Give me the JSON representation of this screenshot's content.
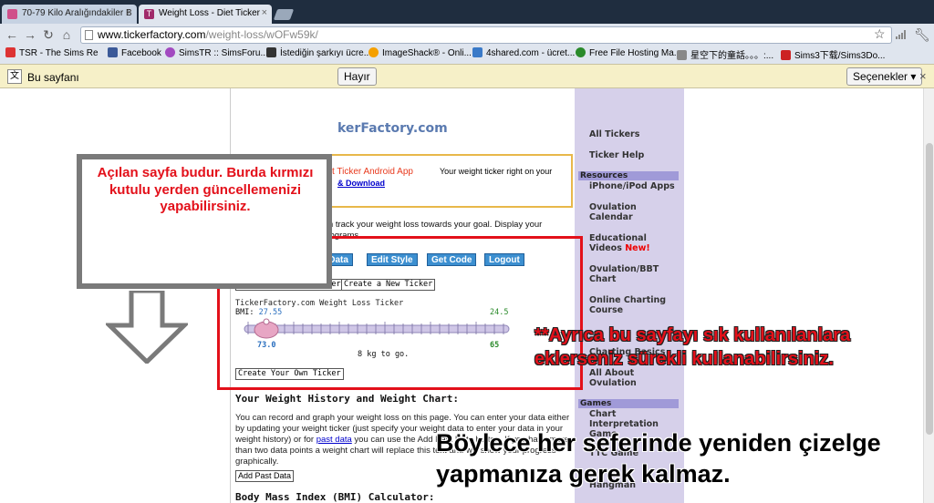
{
  "browser": {
    "tabs": [
      {
        "title": "70-79 Kilo Aralığındakiler B",
        "active": false
      },
      {
        "title": "Weight Loss - Diet Ticker",
        "active": true
      }
    ],
    "url_prefix": "www.tickerfactory.com",
    "url_suffix": "/weight-loss/wOFw59k/",
    "bookmarks": [
      "TSR - The Sims Re",
      "Facebook",
      "SimsTR :: SimsForu...",
      "İstediğin şarkıyı ücre...",
      "ImageShack® - Onli...",
      "4shared.com - ücret...",
      "Free File Hosting Ma...",
      "星空下的童話。。。:...",
      "Sims3下载/Sims3Do..."
    ],
    "infobar": {
      "text": "Bu sayfanı",
      "no_button": "Hayır",
      "options_button": "Seçenekler"
    }
  },
  "site": {
    "logo": "kerFactory.com",
    "promo_title": "t Ticker Android App",
    "promo_desc": "Your weight ticker right on your",
    "promo_download": "& Download",
    "intro": "This weight loss ruler can track your weight loss towards your goal. Display your progress in pounds or kilograms.",
    "buttons": {
      "edit_data": "Edit/Update Weight Data",
      "edit_style": "Edit Style",
      "get_code": "Get Code",
      "logout": "Logout",
      "create_own": "Create Your Own Ticker",
      "create_new": "Create a New Ticker",
      "create_own_2": "Create Your Own Ticker",
      "add_past": "Add Past Data"
    },
    "ticker": {
      "title": "TickerFactory.com Weight Loss Ticker",
      "bmi_label": "BMI:",
      "bmi_value": "27.55",
      "target_bmi": "24.5",
      "start_weight": "73.0",
      "goal_weight": "65",
      "to_go": "8 kg to go.",
      "progress_fraction": 0.0
    },
    "history_heading": "Your Weight History and Weight Chart:",
    "history_text_1": "You can record and graph your weight loss on this page. You can enter your data either by updating your weight ticker (just specify your weight data to enter your data in your weight history) or for ",
    "history_link": "past data",
    "history_text_2": " you can use the Add Past Data button. If you have more than two data points a weight chart will replace this text and will show your progress graphically.",
    "bmi_heading": "Body Mass Index (BMI) Calculator:",
    "sidebar": {
      "all_tickers": "All Tickers",
      "ticker_help": "Ticker Help",
      "resources_head": "Resources",
      "iphone": "iPhone/iPod Apps",
      "ovulation_calendar": "Ovulation Calendar",
      "educational_videos": "Educational Videos",
      "new_badge": "New!",
      "ovulation_bbt": "Ovulation/BBT Chart",
      "online_charting": "Online Charting Course",
      "charting_basics": "Charting Basics",
      "all_about": "All About Ovulation",
      "games_head": "Games",
      "chart_interpretation": "Chart Interpretation Game",
      "ttc_game": "TTC Game",
      "hangman": "Hangman"
    }
  },
  "annotations": {
    "callout": "Açılan sayfa budur. Burda kırmızı kutulu yerden güncellemenizi yapabilirsiniz.",
    "note_red": "**Ayrıca bu sayfayı sık kullanılanlara eklerseniz sürekli kullanabilirsiniz.",
    "note_black": "Böylece her seferinde yeniden  çizelge yapmanıza gerek kalmaz."
  },
  "colors": {
    "highlight_red": "#e3101a",
    "button_blue": "#3c8fd0",
    "sidebar_bg": "#d6d0ea"
  }
}
